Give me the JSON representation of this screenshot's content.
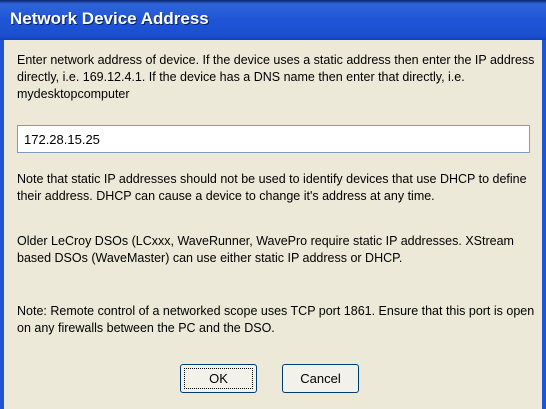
{
  "dialog": {
    "title": "Network Device Address",
    "intro_text": "Enter network address of device. If the device uses a static address then enter the IP address directly, i.e. 169.12.4.1. If the device has a DNS name then enter that directly, i.e. mydesktopcomputer",
    "address_value": "172.28.15.25",
    "note_static": "Note that static IP addresses should not be used to identify devices that use DHCP to define their address. DHCP can cause a device to change it's address at any time.",
    "note_older": "Older LeCroy DSOs (LCxxx, WaveRunner, WavePro require static IP addresses. XStream based DSOs (WaveMaster) can use either static IP address or DHCP.",
    "note_port": "Note: Remote control of a networked scope uses TCP port 1861. Ensure that this port is open on any firewalls between the PC and the DSO.",
    "ok_label": "OK",
    "cancel_label": "Cancel"
  },
  "colors": {
    "title_bar": "#1e55d6",
    "dialog_background": "#ece9d8",
    "title_text": "#ffffff"
  }
}
